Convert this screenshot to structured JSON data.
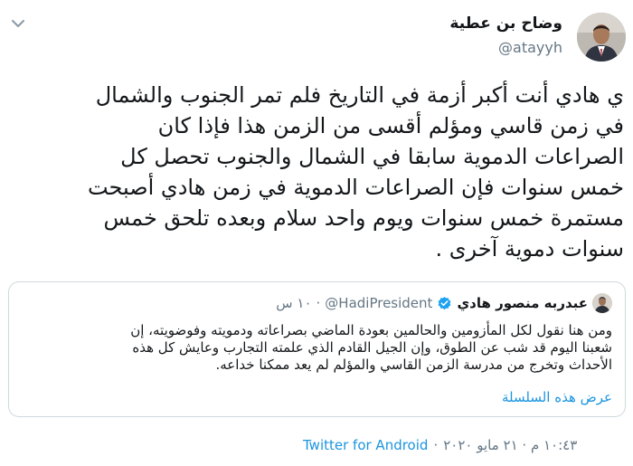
{
  "author": {
    "name": "وضاح بن عطية",
    "handle": "@atayyh"
  },
  "tweet": {
    "lines": [
      "ي هادي أنت أكبر أزمة في التاريخ فلم تمر الجنوب والشمال",
      "في زمن قاسي ومؤلم أقسى من الزمن هذا فإذا كان",
      "الصراعات الدموية سابقا في الشمال والجنوب تحصل كل",
      "خمس سنوات فإن الصراعات الدموية في زمن هادي أصبحت",
      "مستمرة خمس سنوات ويوم واحد سلام وبعده تلحق خمس",
      "سنوات دموية آخرى ."
    ]
  },
  "quoted_tweet": {
    "name": "عبدربه منصور هادي",
    "handle": "@HadiPresident",
    "separator": "·",
    "time": "١٠ س",
    "body_lines": [
      "ومن هنا نقول لكل المأزومين والحالمين بعودة الماضي بصراعاته ودمويته وفوضويته، إن",
      "شعبنا اليوم قد شب عن الطوق، وإن الجيل القادم الذي علمته التجارب وعايش كل هذه",
      "الأحداث وتخرج من مدرسة الزمن القاسي والمؤلم لم يعد ممكنا خداعه."
    ],
    "show_thread_label": "عرض هذه السلسلة"
  },
  "meta": {
    "datetime": "١٠:٤٣ م · ٢١ مايو ٢٠٢٠",
    "separator": "·",
    "source": "Twitter for Android"
  },
  "icons": {
    "menu": "chevron-down-icon",
    "verified": "verified-badge-icon"
  },
  "colors": {
    "link": "#1b95e0",
    "secondary_text": "#657786",
    "primary_text": "#14171a",
    "border": "#cfd9de",
    "verified": "#1da1f2"
  }
}
